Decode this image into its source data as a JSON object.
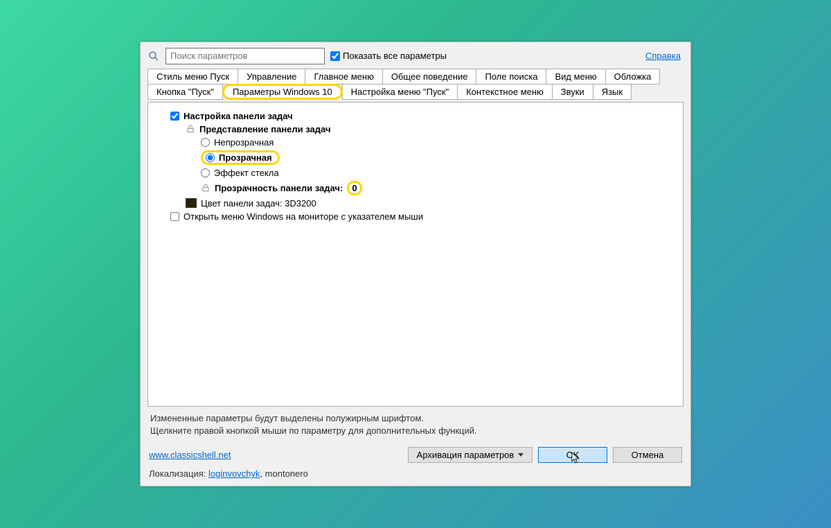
{
  "search": {
    "placeholder": "Поиск параметров"
  },
  "show_all": {
    "label": "Показать все параметры",
    "checked": true
  },
  "help_link": "Справка",
  "tabs": {
    "row1": [
      "Стиль меню Пуск",
      "Управление",
      "Главное меню",
      "Общее поведение",
      "Поле поиска",
      "Вид меню",
      "Обложка"
    ],
    "row2": [
      "Кнопка \"Пуск\"",
      "Параметры Windows 10",
      "Настройка меню \"Пуск\"",
      "Контекстное меню",
      "Звуки",
      "Язык"
    ]
  },
  "tree": {
    "taskbar_settings": {
      "label": "Настройка панели задач",
      "checked": true
    },
    "taskbar_appearance_group": "Представление панели задач",
    "opaque": "Непрозрачная",
    "transparent": "Прозрачная",
    "glass": "Эффект стекла",
    "transparency_label": "Прозрачность панели задач:",
    "transparency_value": "0",
    "color_label": "Цвет панели задач: 3D3200",
    "open_on_monitor": {
      "label": "Открыть меню Windows на мониторе с указателем мыши",
      "checked": false
    }
  },
  "hints": {
    "line1": "Измененные параметры будут выделены полужирным шрифтом.",
    "line2": "Щелкните правой кнопкой мыши по параметру для дополнительных функций."
  },
  "buttons": {
    "archive": "Архивация параметров",
    "ok": "OK",
    "cancel": "Отмена"
  },
  "footer": {
    "site": "www.classicshell.net",
    "localization_label": "Локализация:",
    "translator1": "loginvovchyk",
    "sep": ", ",
    "translator2": "montonero"
  }
}
